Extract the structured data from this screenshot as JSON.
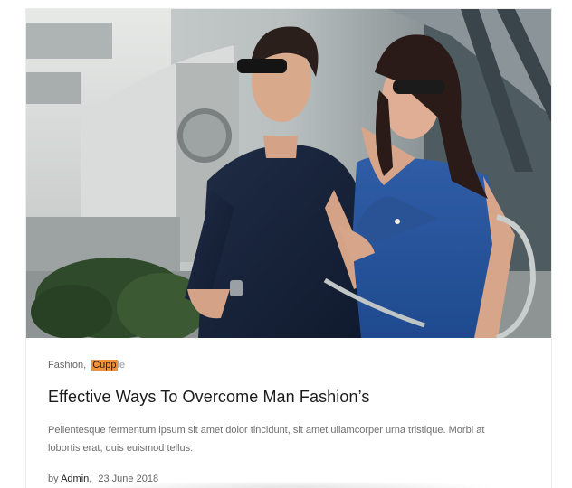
{
  "post": {
    "categories": [
      {
        "label": "Fashion"
      },
      {
        "label_highlight": "Cupp",
        "label_rest": "le"
      }
    ],
    "category_separator": ",",
    "title": "Effective Ways To Overcome Man Fashion’s",
    "excerpt": "Pellentesque fermentum ipsum sit amet dolor tincidunt, sit amet ullamcorper urna tristique. Morbi at lobortis erat, quis euismod tellus.",
    "meta": {
      "by_label": "by",
      "author": "Admin",
      "separator": ",",
      "date": "23 June 2018"
    },
    "image": {
      "icon": "photo-couple"
    }
  },
  "colors": {
    "highlight": "#f0913d",
    "title": "#1b1b1b",
    "text": "#6f6f6f"
  }
}
